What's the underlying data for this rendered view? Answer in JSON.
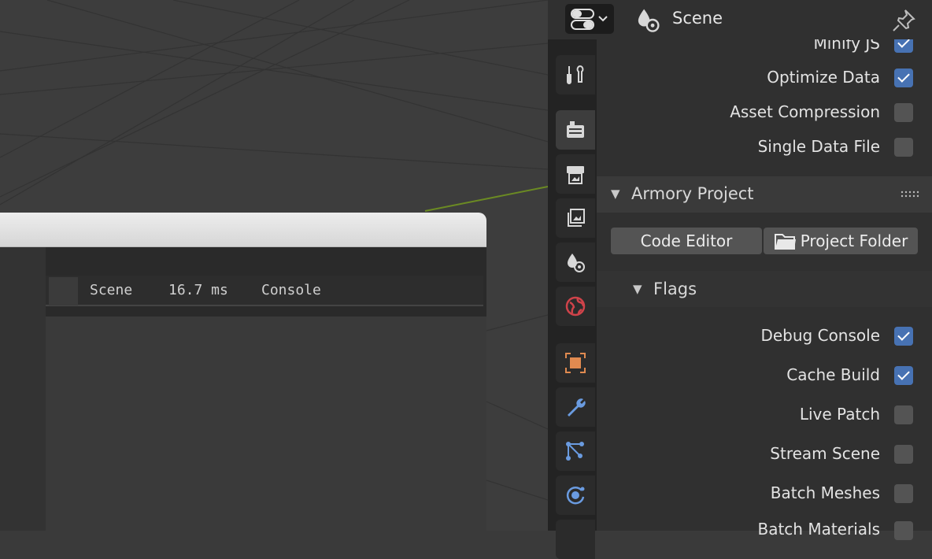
{
  "player": {
    "hud_tabs": [
      "Scene",
      "16.7 ms",
      "Console"
    ]
  },
  "properties": {
    "header_title": "Scene",
    "export_options": [
      {
        "label": "Minify JS",
        "checked": true
      },
      {
        "label": "Optimize Data",
        "checked": true
      },
      {
        "label": "Asset Compression",
        "checked": false
      },
      {
        "label": "Single Data File",
        "checked": false
      }
    ],
    "armory_project": {
      "title": "Armory Project",
      "code_editor_label": "Code Editor",
      "project_folder_label": "Project Folder",
      "flags_title": "Flags",
      "flags": [
        {
          "label": "Debug Console",
          "checked": true
        },
        {
          "label": "Cache Build",
          "checked": true
        },
        {
          "label": "Live Patch",
          "checked": false
        },
        {
          "label": "Stream Scene",
          "checked": false
        },
        {
          "label": "Batch Meshes",
          "checked": false
        },
        {
          "label": "Batch Materials",
          "checked": false
        }
      ]
    },
    "tabs": [
      "tool-icon",
      "render-icon",
      "output-icon",
      "view-layer-icon",
      "scene-icon",
      "world-icon",
      "object-icon",
      "modifier-icon",
      "particles-icon",
      "physics-icon"
    ]
  },
  "colors": {
    "accent": "#4772b3",
    "object": "#e08a50",
    "world": "#d0434a",
    "modifier": "#6a9be0",
    "x_axis_line": "#6b8a23"
  }
}
